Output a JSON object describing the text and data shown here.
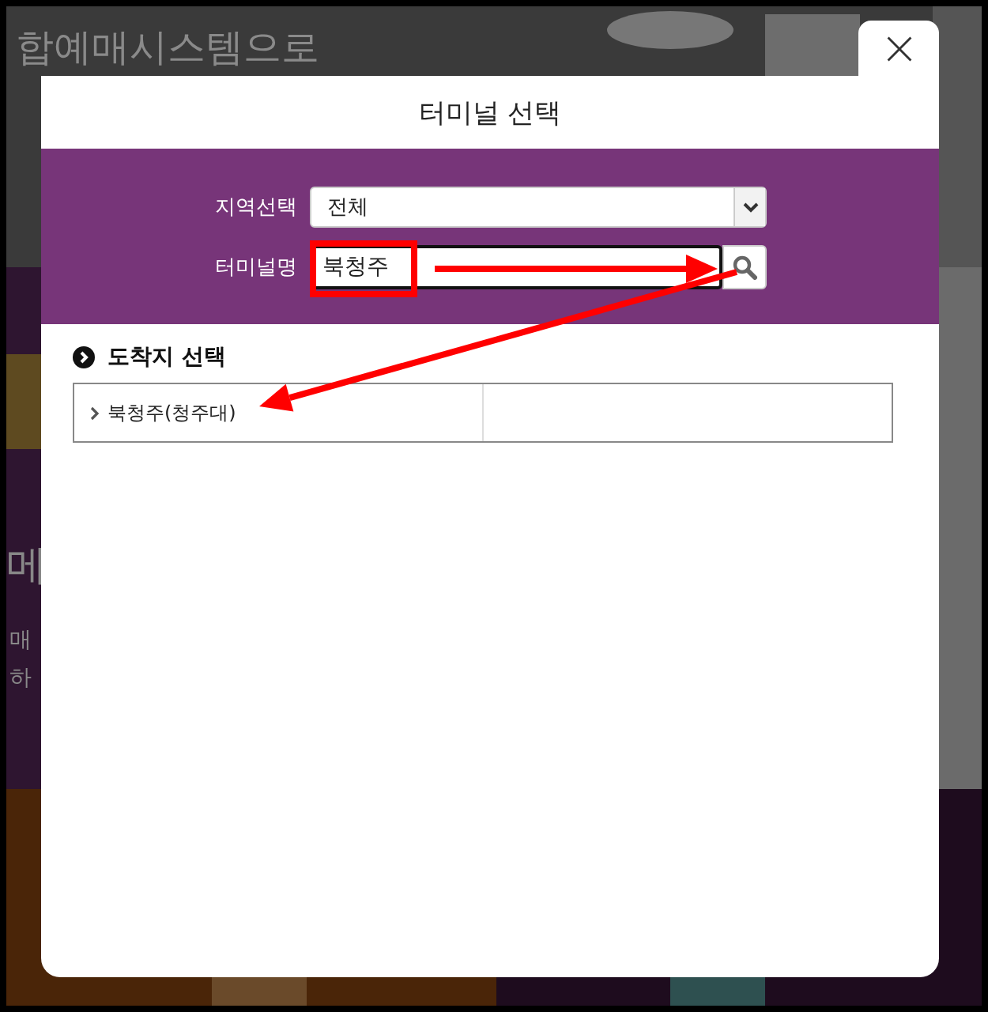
{
  "background_page": {
    "texts": [
      "합예매시스템으로",
      "메",
      "매",
      "하"
    ]
  },
  "dialog": {
    "title": "터미널 선택",
    "region": {
      "label": "지역선택",
      "value": "전체"
    },
    "terminal": {
      "label": "터미널명",
      "value": "북청주"
    },
    "section_title": "도착지 선택",
    "results": [
      {
        "name": "북청주(청주대)"
      }
    ]
  },
  "annotations": [
    {
      "kind": "box"
    },
    {
      "kind": "arrow"
    },
    {
      "kind": "arrow"
    }
  ]
}
